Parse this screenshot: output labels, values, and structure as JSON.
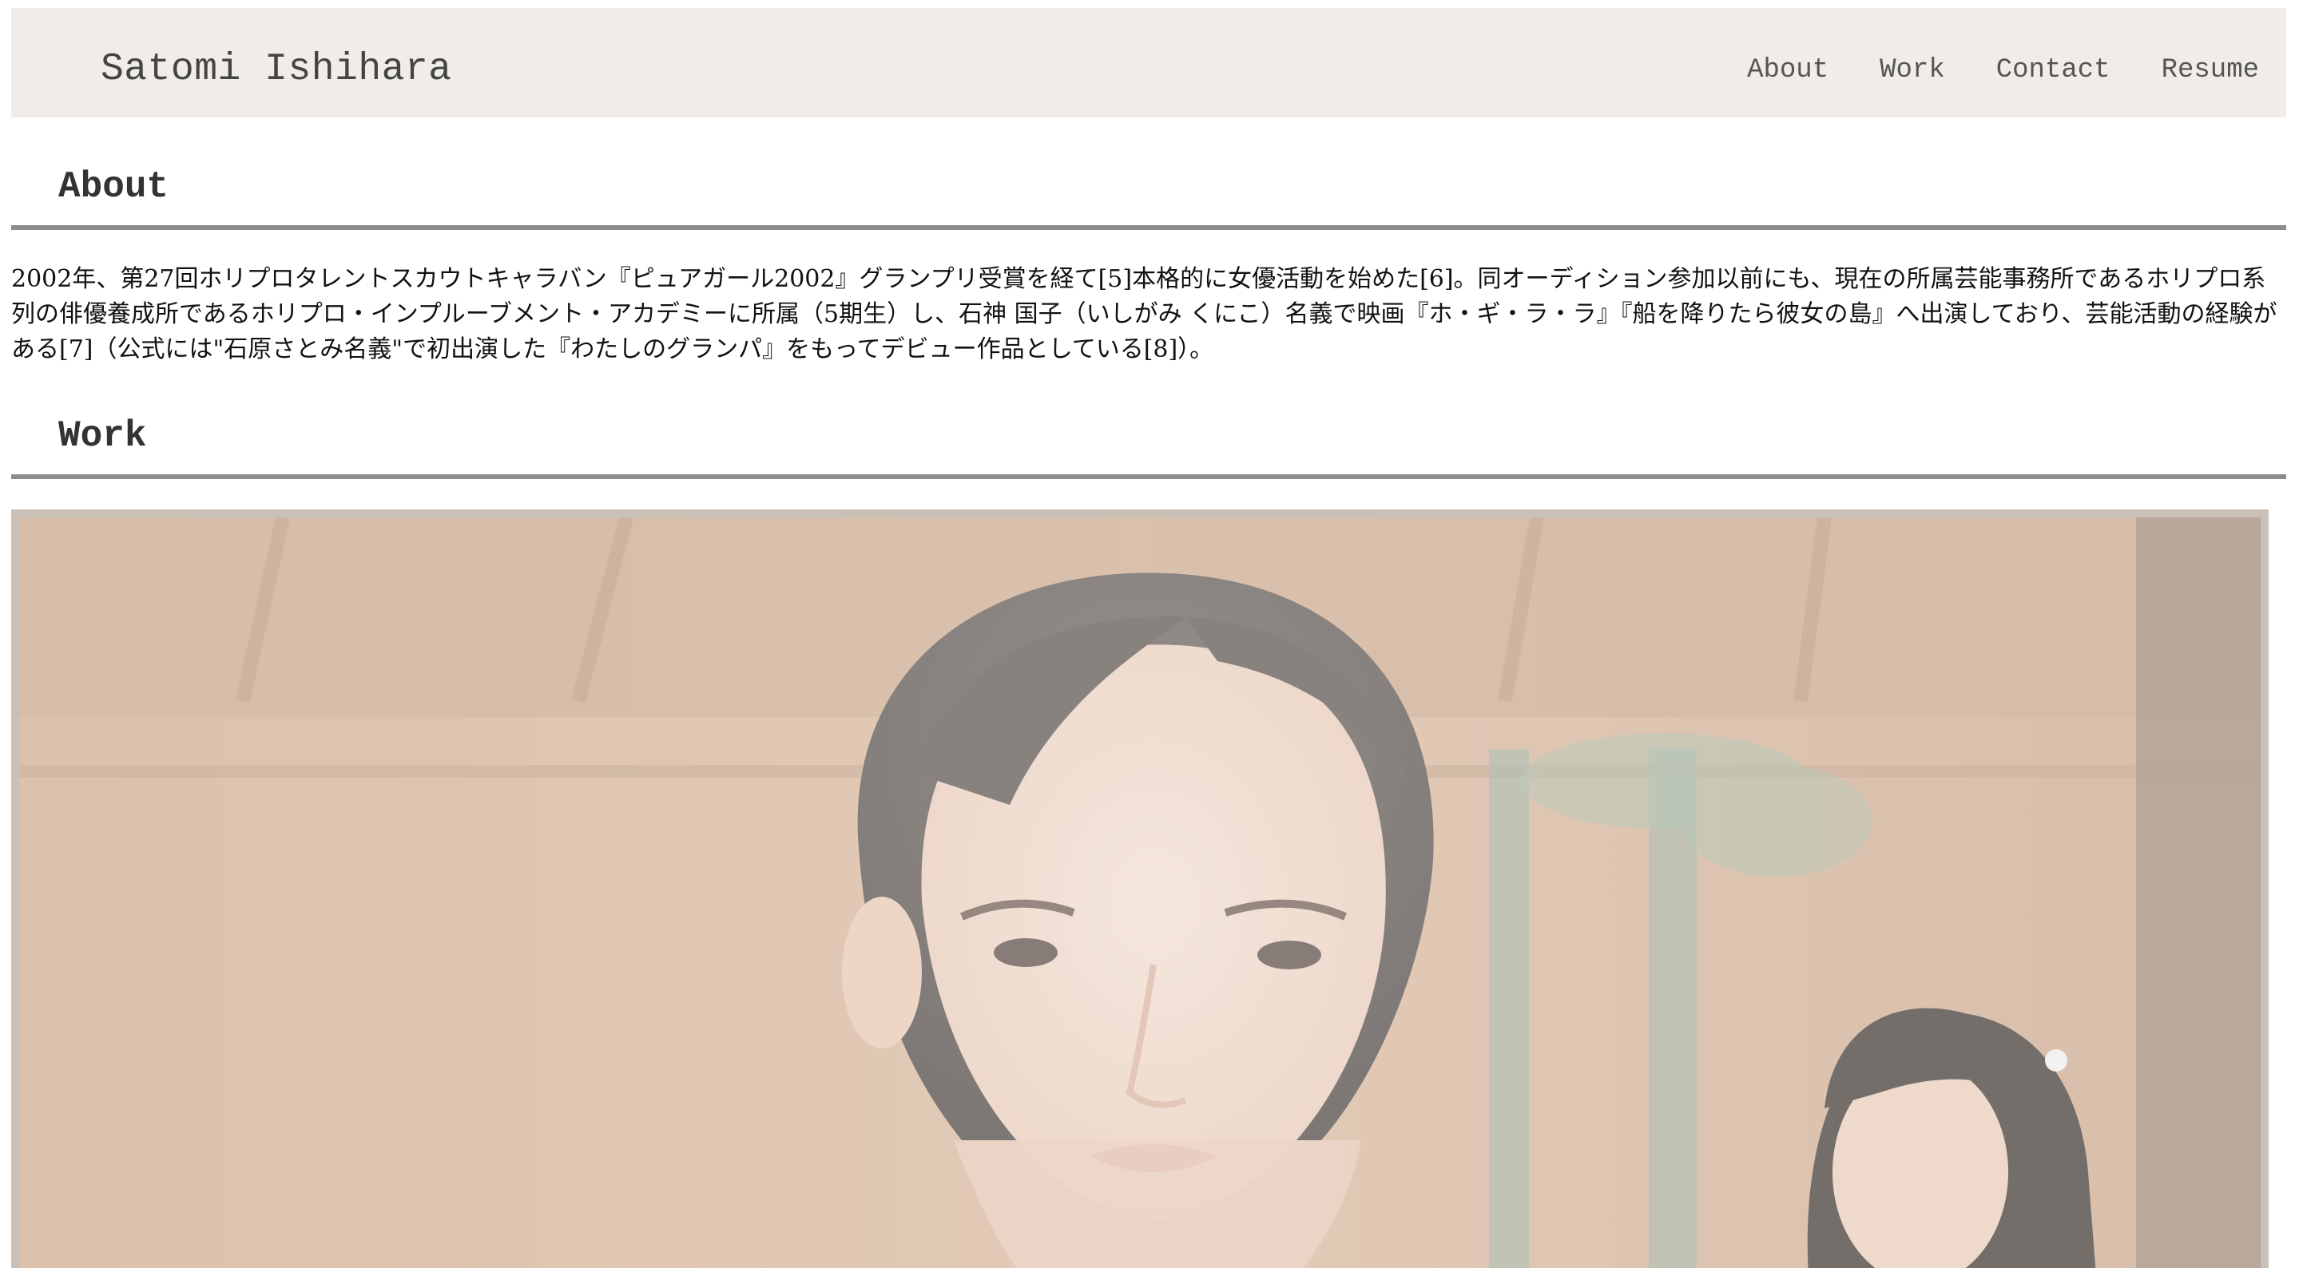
{
  "header": {
    "site_title": "Satomi Ishihara",
    "nav": {
      "about": "About",
      "work": "Work",
      "contact": "Contact",
      "resume": "Resume"
    }
  },
  "about": {
    "heading": "About",
    "paragraph": "2002年、第27回ホリプロタレントスカウトキャラバン『ピュアガール2002』グランプリ受賞を経て[5]本格的に女優活動を始めた[6]。同オーディション参加以前にも、現在の所属芸能事務所であるホリプロ系列の俳優養成所であるホリプロ・インプルーブメント・アカデミーに所属（5期生）し、石神 国子（いしがみ くにこ）名義で映画『ホ・ギ・ラ・ラ』『船を降りたら彼女の島』へ出演しており、芸能活動の経験がある[7]（公式には\"石原さとみ名義\"で初出演した『わたしのグランパ』をもってデビュー作品としている[8]）。"
  },
  "work": {
    "heading": "Work"
  },
  "colors": {
    "header_bg": "#f0ece7",
    "rule": "#8c8c8c",
    "photo_frame": "#c9c1b8"
  }
}
